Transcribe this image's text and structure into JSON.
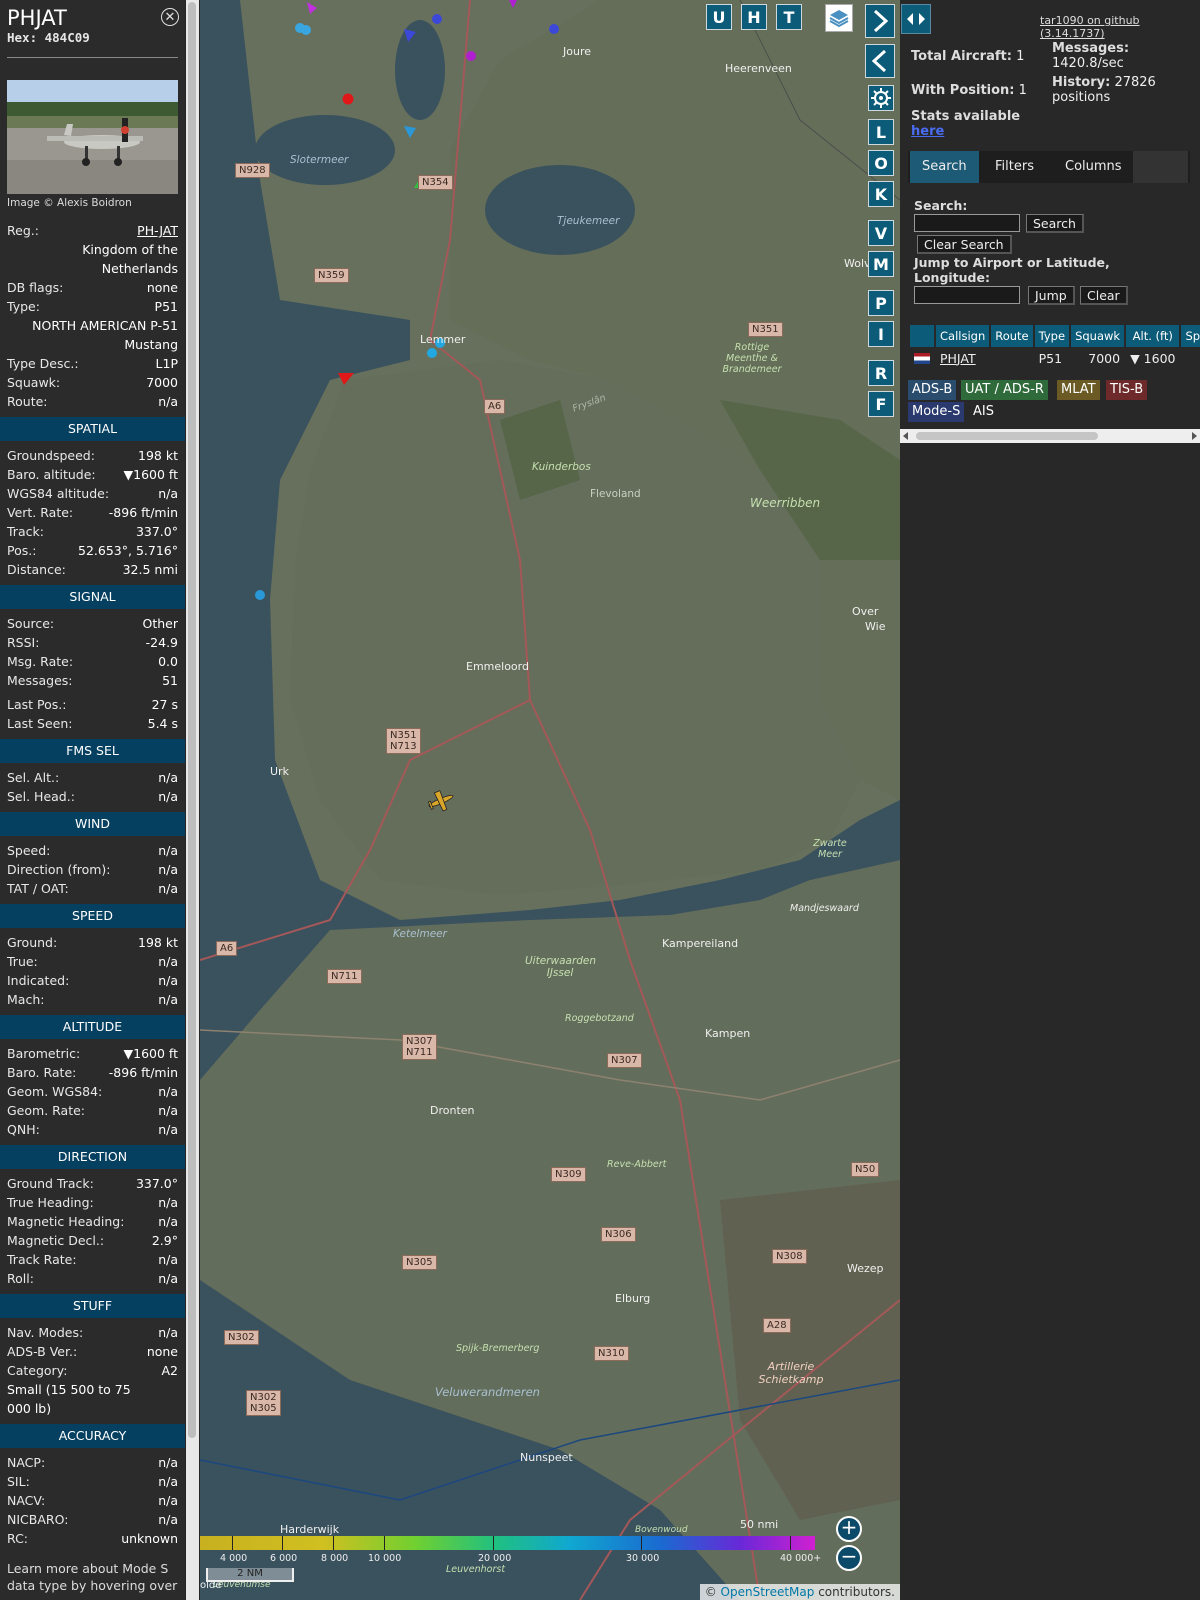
{
  "sidebar": {
    "callsign": "PHJAT",
    "hex": "Hex: 484C09",
    "image_credit": "Image © Alexis Boidron",
    "basic": [
      {
        "k": "Reg.:",
        "v": "PH-JAT",
        "link": true
      },
      {
        "k": "",
        "v": "Kingdom of the Netherlands"
      },
      {
        "k": "DB flags:",
        "v": "none"
      },
      {
        "k": "Type:",
        "v": "P51"
      },
      {
        "k": "",
        "v": "NORTH AMERICAN P-51 Mustang"
      },
      {
        "k": "Type Desc.:",
        "v": "L1P"
      },
      {
        "k": "Squawk:",
        "v": "7000"
      },
      {
        "k": "Route:",
        "v": "n/a"
      }
    ],
    "sections": [
      {
        "title": "SPATIAL",
        "rows": [
          {
            "k": "Groundspeed:",
            "v": "198 kt"
          },
          {
            "k": "Baro. altitude:",
            "v": "▼1600 ft"
          },
          {
            "k": "WGS84 altitude:",
            "v": "n/a"
          },
          {
            "k": "Vert. Rate:",
            "v": "-896 ft/min"
          },
          {
            "k": "Track:",
            "v": "337.0°"
          },
          {
            "k": "Pos.:",
            "v": "52.653°, 5.716°"
          },
          {
            "k": "Distance:",
            "v": "32.5 nmi"
          }
        ]
      },
      {
        "title": "SIGNAL",
        "rows": [
          {
            "k": "Source:",
            "v": "Other"
          },
          {
            "k": "RSSI:",
            "v": "-24.9"
          },
          {
            "k": "Msg. Rate:",
            "v": "0.0"
          },
          {
            "k": "Messages:",
            "v": "51"
          },
          {
            "k": "Last Pos.:",
            "v": "27 s"
          },
          {
            "k": "Last Seen:",
            "v": "5.4 s"
          }
        ]
      },
      {
        "title": "FMS SEL",
        "rows": [
          {
            "k": "Sel. Alt.:",
            "v": "n/a"
          },
          {
            "k": "Sel. Head.:",
            "v": "n/a"
          }
        ]
      },
      {
        "title": "WIND",
        "rows": [
          {
            "k": "Speed:",
            "v": "n/a"
          },
          {
            "k": "Direction (from):",
            "v": "n/a"
          },
          {
            "k": "TAT / OAT:",
            "v": "n/a"
          }
        ]
      },
      {
        "title": "SPEED",
        "rows": [
          {
            "k": "Ground:",
            "v": "198 kt"
          },
          {
            "k": "True:",
            "v": "n/a"
          },
          {
            "k": "Indicated:",
            "v": "n/a"
          },
          {
            "k": "Mach:",
            "v": "n/a"
          }
        ]
      },
      {
        "title": "ALTITUDE",
        "rows": [
          {
            "k": "Barometric:",
            "v": "▼1600 ft"
          },
          {
            "k": "Baro. Rate:",
            "v": "-896 ft/min"
          },
          {
            "k": "Geom. WGS84:",
            "v": "n/a"
          },
          {
            "k": "Geom. Rate:",
            "v": "n/a"
          },
          {
            "k": "QNH:",
            "v": "n/a"
          }
        ]
      },
      {
        "title": "DIRECTION",
        "rows": [
          {
            "k": "Ground Track:",
            "v": "337.0°"
          },
          {
            "k": "True Heading:",
            "v": "n/a"
          },
          {
            "k": "Magnetic Heading:",
            "v": "n/a"
          },
          {
            "k": "Magnetic Decl.:",
            "v": "2.9°"
          },
          {
            "k": "Track Rate:",
            "v": "n/a"
          },
          {
            "k": "Roll:",
            "v": "n/a"
          }
        ]
      },
      {
        "title": "STUFF",
        "rows": [
          {
            "k": "Nav. Modes:",
            "v": "n/a"
          },
          {
            "k": "ADS-B Ver.:",
            "v": "none"
          },
          {
            "k": "Category:",
            "v": "A2"
          },
          {
            "k": "",
            "v": "Small (15 500 to 75 000 lb)",
            "left": true
          }
        ]
      },
      {
        "title": "ACCURACY",
        "rows": [
          {
            "k": "NACP:",
            "v": "n/a"
          },
          {
            "k": "SIL:",
            "v": "n/a"
          },
          {
            "k": "NACV:",
            "v": "n/a"
          },
          {
            "k": "NICBARO:",
            "v": "n/a"
          },
          {
            "k": "RC:",
            "v": "unknown"
          }
        ]
      }
    ],
    "footer": "Learn more about Mode S data type by hovering over"
  },
  "map": {
    "buttons_top": [
      "U",
      "H",
      "T"
    ],
    "buttons_side": [
      "L",
      "O",
      "K",
      "V",
      "M",
      "P",
      "I",
      "R",
      "F"
    ],
    "places": [
      "Joure",
      "Heerenveen",
      "Lemmer",
      "Emmeloord",
      "Urk",
      "Kampereiland",
      "Kampen",
      "Dronten",
      "Elburg",
      "Wezep",
      "Nunspeet",
      "Harderwijk",
      "Flevoland",
      "Kuinderbos",
      "Weerribben",
      "Slotermeer",
      "Tjeukemeer",
      "Rottige Meenthe & Brandemeer",
      "Ketelmeer",
      "Uiterwaarden IJssel",
      "Roggebotzand",
      "Reve-Abbert",
      "Zwarte Meer",
      "Mandjeswaard",
      "Spijk-Bremerberg",
      "Veluwerandmeren",
      "Artillerie Schietkamp",
      "Leuvenhorst",
      "Fryslân",
      "Wolv",
      "Over",
      "Wie",
      "Bovenwoud",
      "Leuvenumse",
      "olde"
    ],
    "road_signs": [
      "N928",
      "N354",
      "N359",
      "N351",
      "A6",
      "N351\nN713",
      "A6",
      "N711",
      "N307\nN711",
      "N307",
      "N309",
      "N306",
      "N305",
      "N302",
      "N302\nN305",
      "N310",
      "A28",
      "N308",
      "N50"
    ],
    "altitude_scale": [
      "4 000",
      "6 000",
      "8 000",
      "10 000",
      "20 000",
      "30 000",
      "40 000+"
    ],
    "scale_nm": "2 NM",
    "scale_nmi": "50 nmi",
    "attribution_prefix": "© ",
    "attribution_link": "OpenStreetMap",
    "attribution_suffix": " contributors."
  },
  "panel": {
    "github": "tar1090 on github (3.14.1737)",
    "total_aircraft_label": "Total Aircraft:",
    "total_aircraft": "1",
    "with_position_label": "With Position:",
    "with_position": "1",
    "messages_label": "Messages:",
    "messages_rate": "1420.8/sec",
    "history_label": "History:",
    "history_value": "27826",
    "history_unit": "positions",
    "stats_text": "Stats available",
    "stats_link": "here",
    "tabs": [
      "Search",
      "Filters",
      "Columns"
    ],
    "search_label": "Search:",
    "search_button": "Search",
    "clear_search_button": "Clear Search",
    "jump_label": "Jump to Airport or Latitude, Longitude:",
    "jump_button": "Jump",
    "clear_button": "Clear",
    "columns": [
      "Callsign",
      "Route",
      "Type",
      "Squawk",
      "Alt. (ft)",
      "Spd"
    ],
    "rows": [
      {
        "callsign": "PHJAT",
        "route": "",
        "type": "P51",
        "squawk": "7000",
        "alt": "▼ 1600",
        "spd": ""
      }
    ],
    "sources": [
      {
        "label": "ADS-B",
        "color": "#2a4d6e"
      },
      {
        "label": "UAT / ADS-R",
        "color": "#2f6a3a"
      },
      {
        "label": "MLAT",
        "color": "#6b5a24"
      },
      {
        "label": "TIS-B",
        "color": "#6e2a2a"
      },
      {
        "label": "Mode-S",
        "color": "#2a3a6e"
      },
      {
        "label": "AIS",
        "color": "#282828"
      }
    ]
  }
}
